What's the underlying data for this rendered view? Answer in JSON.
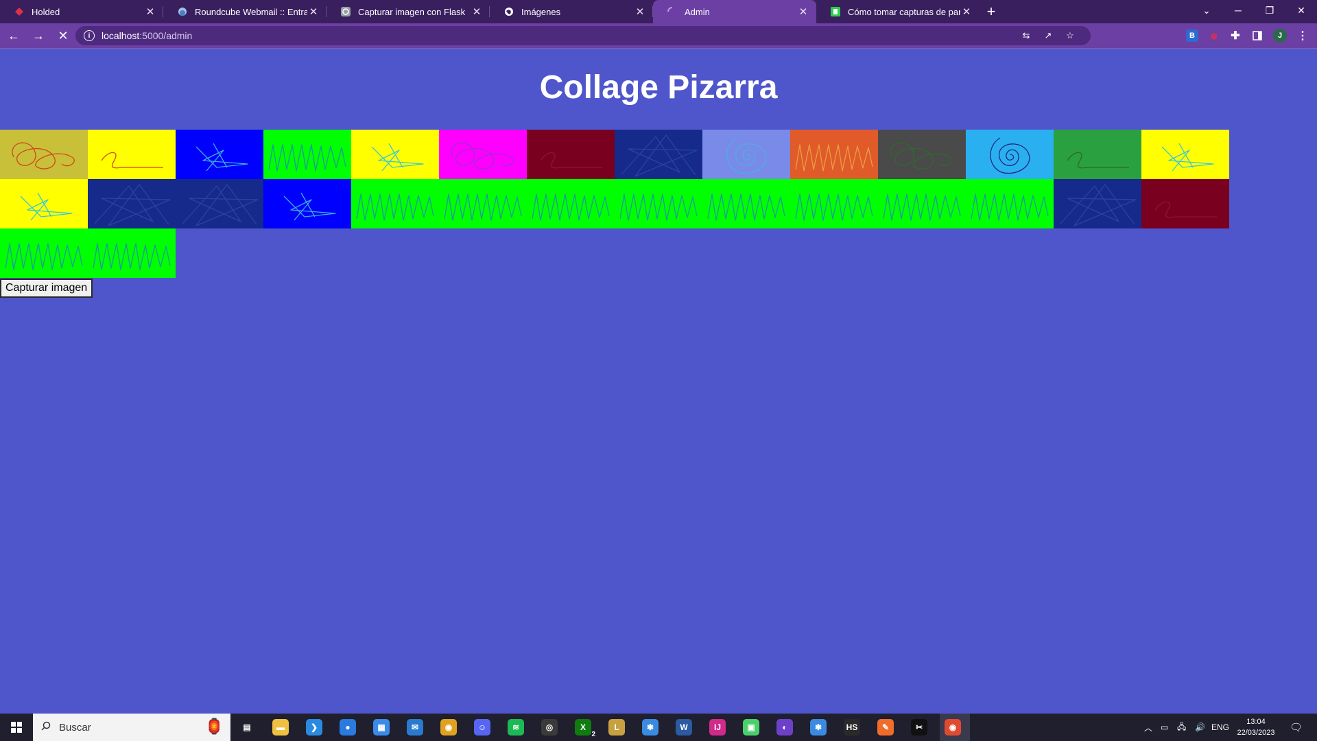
{
  "browser": {
    "tabs": [
      {
        "title": "Holded",
        "icon": "holded-icon",
        "active": false
      },
      {
        "title": "Roundcube Webmail :: Entrada",
        "icon": "roundcube-icon",
        "active": false
      },
      {
        "title": "Capturar imagen con Flask",
        "icon": "openai-icon",
        "active": false
      },
      {
        "title": "Imágenes",
        "icon": "globe-icon",
        "active": false
      },
      {
        "title": "Admin",
        "icon": "loading-icon",
        "active": true
      },
      {
        "title": "Cómo tomar capturas de pantalla",
        "icon": "screenshot-site-icon",
        "active": false
      }
    ],
    "url_host": "localhost",
    "url_path": ":5000/admin",
    "profile_initial": "J"
  },
  "page": {
    "title": "Collage Pizarra",
    "capture_button_label": "Capturar imagen",
    "tiles_row1": [
      {
        "bg": "#c8c038",
        "stroke": "#d0461e",
        "scribble": "loops"
      },
      {
        "bg": "#ffff00",
        "stroke": "#d0461e",
        "scribble": "squiggle"
      },
      {
        "bg": "#0000ff",
        "stroke": "#3aaee0",
        "scribble": "plane"
      },
      {
        "bg": "#00ff00",
        "stroke": "#1a9aa0",
        "scribble": "zigzag"
      },
      {
        "bg": "#ffff00",
        "stroke": "#3ac8d8",
        "scribble": "plane"
      },
      {
        "bg": "#ff00ff",
        "stroke": "#9a30d0",
        "scribble": "loops"
      },
      {
        "bg": "#7a0020",
        "stroke": "#8a1a2a",
        "scribble": "squiggle"
      },
      {
        "bg": "#152a8a",
        "stroke": "#2a44a0",
        "scribble": "star"
      },
      {
        "bg": "#7a8ae8",
        "stroke": "#4ab0e0",
        "scribble": "spiral"
      },
      {
        "bg": "#e05a2a",
        "stroke": "#e8a040",
        "scribble": "zigzag"
      },
      {
        "bg": "#4a4a4a",
        "stroke": "#2e6a2e",
        "scribble": "loops"
      },
      {
        "bg": "#2ab0f0",
        "stroke": "#1a2a80",
        "scribble": "spiral"
      },
      {
        "bg": "#2aa040",
        "stroke": "#2a6a2a",
        "scribble": "squiggle"
      },
      {
        "bg": "#ffff00",
        "stroke": "#3ac8d8",
        "scribble": "plane"
      }
    ],
    "tiles_row2": [
      {
        "bg": "#ffff00",
        "stroke": "#3ac8d8",
        "scribble": "plane"
      },
      {
        "bg": "#152a8a",
        "stroke": "#2a44a0",
        "scribble": "star"
      },
      {
        "bg": "#152a8a",
        "stroke": "#2a44a0",
        "scribble": "star"
      },
      {
        "bg": "#0000ff",
        "stroke": "#3aaee0",
        "scribble": "plane"
      },
      {
        "bg": "#00ff00",
        "stroke": "#1a9aa0",
        "scribble": "zigzag"
      },
      {
        "bg": "#00ff00",
        "stroke": "#1a9aa0",
        "scribble": "zigzag"
      },
      {
        "bg": "#00ff00",
        "stroke": "#1a9aa0",
        "scribble": "zigzag"
      },
      {
        "bg": "#00ff00",
        "stroke": "#1a9aa0",
        "scribble": "zigzag"
      },
      {
        "bg": "#00ff00",
        "stroke": "#1a9aa0",
        "scribble": "zigzag"
      },
      {
        "bg": "#00ff00",
        "stroke": "#1a9aa0",
        "scribble": "zigzag"
      },
      {
        "bg": "#00ff00",
        "stroke": "#1a9aa0",
        "scribble": "zigzag"
      },
      {
        "bg": "#00ff00",
        "stroke": "#1a9aa0",
        "scribble": "zigzag"
      },
      {
        "bg": "#152a8a",
        "stroke": "#2a44a0",
        "scribble": "star"
      },
      {
        "bg": "#7a0020",
        "stroke": "#8a1a2a",
        "scribble": "squiggle"
      }
    ],
    "tiles_row3": [
      {
        "bg": "#00ff00",
        "stroke": "#1a9aa0",
        "scribble": "zigzag"
      },
      {
        "bg": "#00ff00",
        "stroke": "#1a9aa0",
        "scribble": "zigzag"
      }
    ]
  },
  "taskbar": {
    "search_placeholder": "Buscar",
    "language": "ENG",
    "time": "13:04",
    "date": "22/03/2023",
    "apps": [
      "task-view-icon",
      "file-explorer-icon",
      "vscode-icon",
      "maps-icon",
      "store-icon",
      "mail-icon",
      "chrome-icon",
      "discord-icon",
      "spotify-icon",
      "obs-icon",
      "xbox-icon",
      "league-icon",
      "app-icon",
      "word-icon",
      "intellij-icon",
      "chat-app-icon",
      "github-icon",
      "app-icon",
      "hs-icon",
      "postman-icon",
      "capcut-icon",
      "chrome-active-icon"
    ],
    "xbox_badge": "2"
  }
}
